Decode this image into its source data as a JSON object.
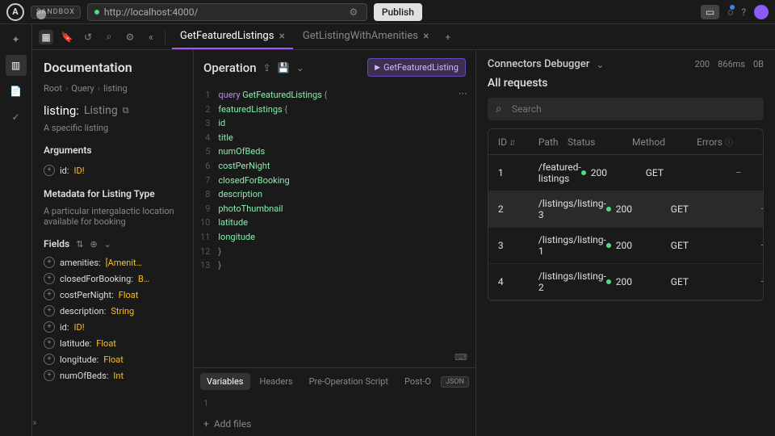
{
  "topbar": {
    "sandbox_label": "SANDBOX",
    "url": "http://localhost:4000/",
    "publish_label": "Publish"
  },
  "tabs": [
    {
      "label": "GetFeaturedListings",
      "active": true
    },
    {
      "label": "GetListingWithAmenities",
      "active": false
    }
  ],
  "sidebar": {
    "title": "Documentation",
    "crumbs": [
      "Root",
      "Query",
      "listing"
    ],
    "type_name": "listing:",
    "type_type": "Listing",
    "type_desc": "A specific listing",
    "arguments_label": "Arguments",
    "arguments": [
      {
        "name": "id:",
        "type": "ID!"
      }
    ],
    "metadata_title": "Metadata for Listing Type",
    "metadata_desc": "A particular intergalactic location available for booking",
    "fields_label": "Fields",
    "fields": [
      {
        "name": "amenities:",
        "type": "[Amenit…"
      },
      {
        "name": "closedForBooking:",
        "type": "B…"
      },
      {
        "name": "costPerNight:",
        "type": "Float"
      },
      {
        "name": "description:",
        "type": "String"
      },
      {
        "name": "id:",
        "type": "ID!"
      },
      {
        "name": "latitude:",
        "type": "Float"
      },
      {
        "name": "longitude:",
        "type": "Float"
      },
      {
        "name": "numOfBeds:",
        "type": "Int"
      }
    ]
  },
  "operation": {
    "title": "Operation",
    "run_label": "GetFeaturedListing",
    "code_lines": [
      [
        {
          "t": "query ",
          "c": "kw"
        },
        {
          "t": "GetFeaturedListings ",
          "c": "fn"
        },
        {
          "t": "{",
          "c": "brace"
        }
      ],
      [
        {
          "t": "  featuredListings ",
          "c": "fld"
        },
        {
          "t": "{",
          "c": "brace"
        }
      ],
      [
        {
          "t": "    id",
          "c": "fld"
        }
      ],
      [
        {
          "t": "    title",
          "c": "fld"
        }
      ],
      [
        {
          "t": "    numOfBeds",
          "c": "fld"
        }
      ],
      [
        {
          "t": "    costPerNight",
          "c": "fld"
        }
      ],
      [
        {
          "t": "    closedForBooking",
          "c": "fld"
        }
      ],
      [
        {
          "t": "    description",
          "c": "fld"
        }
      ],
      [
        {
          "t": "    photoThumbnail",
          "c": "fld"
        }
      ],
      [
        {
          "t": "    latitude",
          "c": "fld"
        }
      ],
      [
        {
          "t": "    longitude",
          "c": "fld"
        }
      ],
      [
        {
          "t": "  }",
          "c": "brace"
        }
      ],
      [
        {
          "t": "}",
          "c": "brace"
        }
      ]
    ],
    "line_count": 13,
    "vars_tabs": [
      "Variables",
      "Headers",
      "Pre-Operation Script",
      "Post-O"
    ],
    "json_badge": "JSON",
    "add_files": "Add files"
  },
  "debugger": {
    "title": "Connectors Debugger",
    "stats": {
      "status": "200",
      "time": "866ms",
      "size": "0B"
    },
    "all_requests": "All requests",
    "search_placeholder": "Search",
    "columns": {
      "id": "ID",
      "path": "Path",
      "status": "Status",
      "method": "Method",
      "errors": "Errors"
    },
    "rows": [
      {
        "id": "1",
        "path": "/featured-listings",
        "status": "200",
        "method": "GET",
        "errors": "–",
        "hover": false
      },
      {
        "id": "2",
        "path": "/listings/listing-3",
        "status": "200",
        "method": "GET",
        "errors": "–",
        "hover": true
      },
      {
        "id": "3",
        "path": "/listings/listing-1",
        "status": "200",
        "method": "GET",
        "errors": "–",
        "hover": false
      },
      {
        "id": "4",
        "path": "/listings/listing-2",
        "status": "200",
        "method": "GET",
        "errors": "–",
        "hover": false
      }
    ]
  }
}
